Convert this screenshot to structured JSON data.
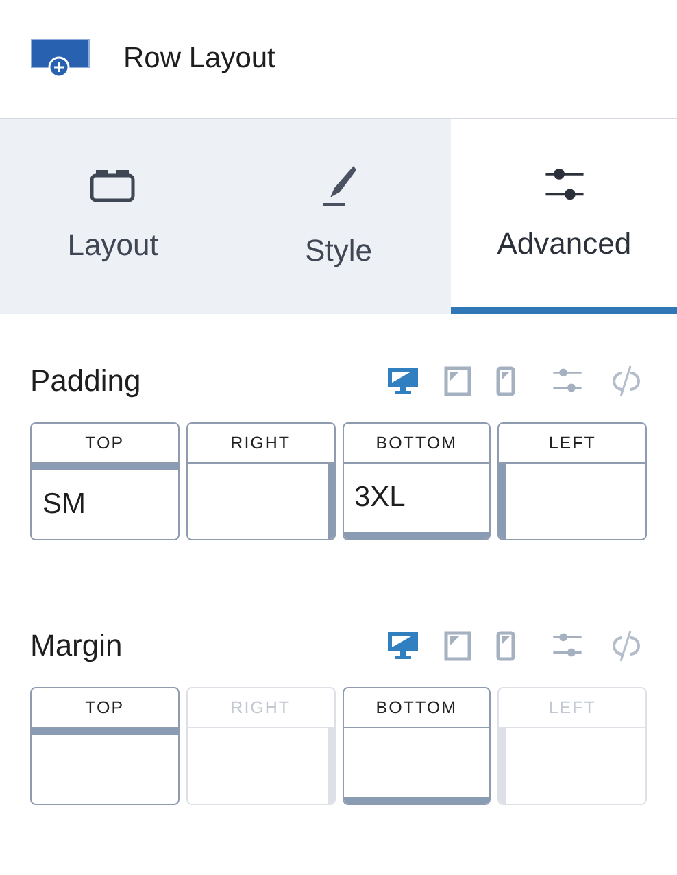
{
  "header": {
    "title": "Row Layout"
  },
  "tabs": [
    {
      "label": "Layout",
      "kind": "layout",
      "selected": false
    },
    {
      "label": "Style",
      "kind": "style",
      "selected": false
    },
    {
      "label": "Advanced",
      "kind": "advanced",
      "selected": true
    }
  ],
  "sections": [
    {
      "title": "Padding",
      "devices": [
        {
          "kind": "desktop",
          "selected": true
        },
        {
          "kind": "tablet",
          "selected": false
        },
        {
          "kind": "mobile",
          "selected": false
        }
      ],
      "sides": [
        {
          "kind": "top",
          "label": "TOP",
          "value": "SM",
          "disabled": false
        },
        {
          "kind": "right",
          "label": "RIGHT",
          "disabled": false
        },
        {
          "kind": "bottom",
          "label": "BOTTOM",
          "value": "3XL",
          "disabled": false
        },
        {
          "kind": "left",
          "label": "LEFT",
          "disabled": false
        }
      ]
    },
    {
      "title": "Margin",
      "devices": [
        {
          "kind": "desktop",
          "selected": true
        },
        {
          "kind": "tablet",
          "selected": false
        },
        {
          "kind": "mobile",
          "selected": false
        }
      ],
      "sides": [
        {
          "kind": "top",
          "label": "TOP",
          "disabled": false
        },
        {
          "kind": "right",
          "label": "RIGHT",
          "disabled": true
        },
        {
          "kind": "bottom",
          "label": "BOTTOM",
          "disabled": false
        },
        {
          "kind": "left",
          "label": "LEFT",
          "disabled": true
        }
      ]
    }
  ]
}
